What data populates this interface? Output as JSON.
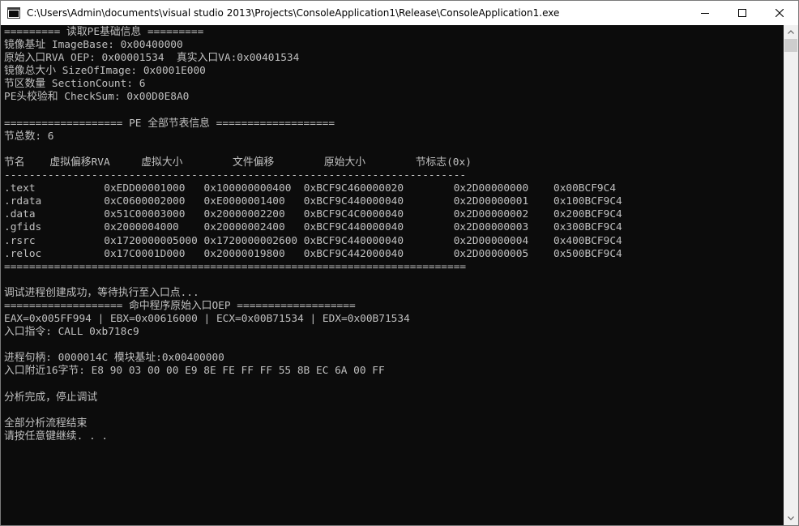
{
  "window": {
    "title": "C:\\Users\\Admin\\documents\\visual studio 2013\\Projects\\ConsoleApplication1\\Release\\ConsoleApplication1.exe"
  },
  "titlebar_buttons": [
    "minimize-icon",
    "maximize-icon",
    "close-icon"
  ],
  "colors": {
    "console_bg": "#0c0c0c",
    "console_text": "#c0c0c0",
    "titlebar_bg": "#ffffff",
    "scrollbar_bg": "#f0f0f0",
    "scroll_thumb": "#cdcdcd"
  },
  "console": {
    "lines": [
      "========= 读取PE基础信息 =========",
      "镜像基址 ImageBase: 0x00400000",
      "原始入口RVA OEP: 0x00001534  真实入口VA:0x00401534",
      "镜像总大小 SizeOfImage: 0x0001E000",
      "节区数量 SectionCount: 6",
      "PE头校验和 CheckSum: 0x00D0E8A0",
      "",
      "=================== PE 全部节表信息 ===================",
      "节总数: 6",
      "",
      "节名    虚拟偏移RVA     虚拟大小        文件偏移        原始大小        节标志(0x)",
      "--------------------------------------------------------------------------",
      ".text           0xEDD00001000   0x100000000400  0xBCF9C460000020        0x2D00000000    0x00BCF9C4",
      ".rdata          0xC0600002000   0xE0000001400   0xBCF9C440000040        0x2D00000001    0x100BCF9C4",
      ".data           0x51C00003000   0x20000002200   0xBCF9C4C0000040        0x2D00000002    0x200BCF9C4",
      ".gfids          0x2000004000    0x20000002400   0xBCF9C440000040        0x2D00000003    0x300BCF9C4",
      ".rsrc           0x1720000005000 0x1720000002600 0xBCF9C440000040        0x2D00000004    0x400BCF9C4",
      ".reloc          0x17C0001D000   0x20000019800   0xBCF9C442000040        0x2D00000005    0x500BCF9C4",
      "==========================================================================",
      "",
      "调试进程创建成功，等待执行至入口点...",
      "=================== 命中程序原始入口OEP ===================",
      "EAX=0x005FF994 | EBX=0x00616000 | ECX=0x00B71534 | EDX=0x00B71534",
      "入口指令: CALL 0xb718c9",
      "",
      "进程句柄: 0000014C 模块基址:0x00400000",
      "入口附近16字节: E8 90 03 00 00 E9 8E FE FF FF 55 8B EC 6A 00 FF",
      "",
      "分析完成，停止调试",
      "",
      "全部分析流程结束",
      "请按任意键继续. . ."
    ]
  }
}
